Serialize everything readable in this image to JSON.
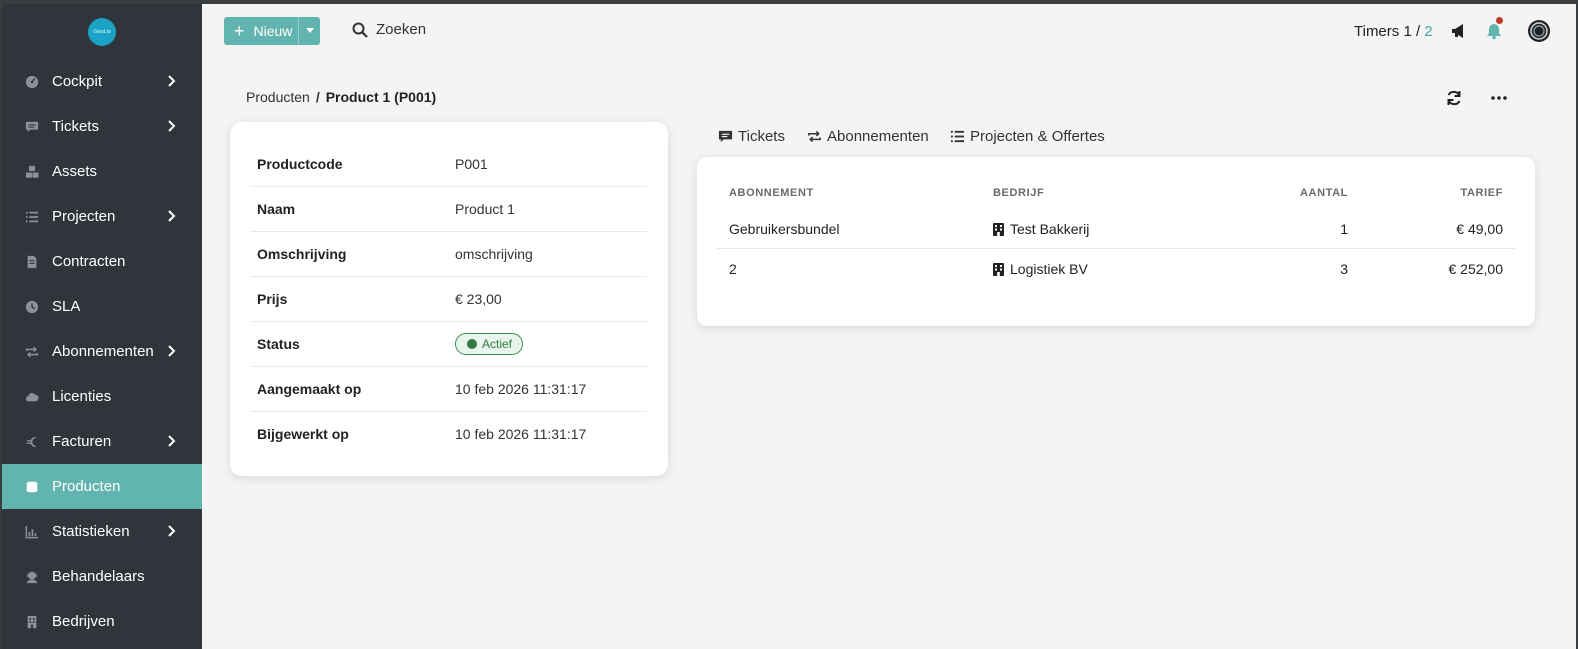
{
  "sidebar": {
    "logo_text": "Gesd.io",
    "items": [
      {
        "label": "Cockpit",
        "icon": "gauge-icon",
        "chevron": true
      },
      {
        "label": "Tickets",
        "icon": "comment-icon",
        "chevron": true
      },
      {
        "label": "Assets",
        "icon": "cubes-icon",
        "chevron": false
      },
      {
        "label": "Projecten",
        "icon": "list-icon",
        "chevron": true
      },
      {
        "label": "Contracten",
        "icon": "file-contract-icon",
        "chevron": false
      },
      {
        "label": "SLA",
        "icon": "clock-icon",
        "chevron": false
      },
      {
        "label": "Abonnementen",
        "icon": "repeat-icon",
        "chevron": true
      },
      {
        "label": "Licenties",
        "icon": "cloud-icon",
        "chevron": false
      },
      {
        "label": "Facturen",
        "icon": "euro-icon",
        "chevron": true
      },
      {
        "label": "Producten",
        "icon": "box-icon",
        "chevron": false,
        "active": true
      },
      {
        "label": "Statistieken",
        "icon": "chart-icon",
        "chevron": true
      },
      {
        "label": "Behandelaars",
        "icon": "headset-icon",
        "chevron": false
      },
      {
        "label": "Bedrijven",
        "icon": "building-icon",
        "chevron": false
      }
    ]
  },
  "topbar": {
    "new_label": "Nieuw",
    "search_label": "Zoeken",
    "timers_label": "Timers 1 /",
    "timers_total": "2"
  },
  "breadcrumb": {
    "parent": "Producten",
    "separator": "/",
    "current": "Product 1 (P001)"
  },
  "details": [
    {
      "label": "Productcode",
      "value": "P001"
    },
    {
      "label": "Naam",
      "value": "Product 1"
    },
    {
      "label": "Omschrijving",
      "value": "omschrijving"
    },
    {
      "label": "Prijs",
      "value": "€ 23,00"
    },
    {
      "label": "Status",
      "value": "Actief",
      "badge": true
    },
    {
      "label": "Aangemaakt op",
      "value": "10 feb 2026 11:31:17"
    },
    {
      "label": "Bijgewerkt op",
      "value": "10 feb 2026 11:31:17"
    }
  ],
  "tabs": [
    {
      "label": "Tickets",
      "icon": "comment-icon"
    },
    {
      "label": "Abonnementen",
      "icon": "repeat-icon",
      "active": true
    },
    {
      "label": "Projecten & Offertes",
      "icon": "list-icon"
    }
  ],
  "table": {
    "headers": [
      "ABONNEMENT",
      "BEDRIJF",
      "AANTAL",
      "TARIEF"
    ],
    "rows": [
      {
        "abonnement": "Gebruikersbundel",
        "bedrijf": "Test Bakkerij",
        "aantal": "1",
        "tarief": "€ 49,00"
      },
      {
        "abonnement": "2",
        "bedrijf": "Logistiek BV",
        "aantal": "3",
        "tarief": "€ 252,00"
      }
    ]
  },
  "colors": {
    "sidebar_bg": "#2f353b",
    "accent": "#62b5ae",
    "badge_green": "#2f7a45",
    "notification": "#c0392b"
  }
}
